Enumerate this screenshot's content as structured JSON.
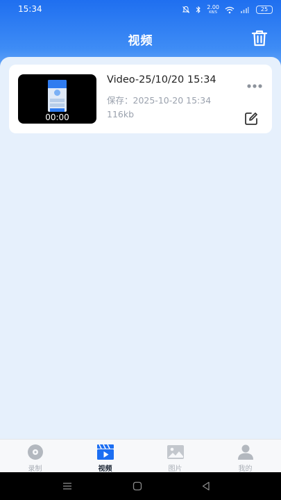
{
  "status_bar": {
    "time": "15:34",
    "net_speed_value": "2.00",
    "net_speed_unit": "KB/S",
    "battery": "25"
  },
  "header": {
    "title": "视频",
    "trash_icon": "trash-icon"
  },
  "videos": [
    {
      "title": "Video-25/10/20 15:34",
      "duration": "00:00",
      "saved": "保存：2025-10-20 15:34",
      "size": "116kb"
    }
  ],
  "bottom_nav": {
    "items": [
      {
        "label": "录制",
        "icon": "record-disc-icon",
        "active": false
      },
      {
        "label": "视频",
        "icon": "video-clapper-icon",
        "active": true
      },
      {
        "label": "图片",
        "icon": "image-icon",
        "active": false
      },
      {
        "label": "我的",
        "icon": "person-icon",
        "active": false
      }
    ]
  },
  "colors": {
    "header_blue": "#1f6ff0",
    "background": "#e6f0fc",
    "active_icon": "#1c6ef2",
    "inactive": "#a9aeb6"
  }
}
